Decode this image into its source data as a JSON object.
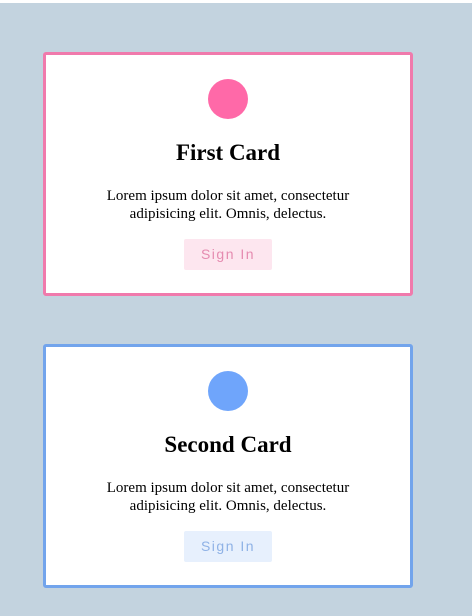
{
  "cards": [
    {
      "title": "First Card",
      "text": "Lorem ipsum dolor sit amet, consectetur adipisicing elit. Omnis, delectus.",
      "button_label": "Sign In",
      "accent_color": "#f07aac"
    },
    {
      "title": "Second Card",
      "text": "Lorem ipsum dolor sit amet, consectetur adipisicing elit. Omnis, delectus.",
      "button_label": "Sign In",
      "accent_color": "#72a4ec"
    }
  ],
  "colors": {
    "page_background": "#c3d3df",
    "pink_dot": "#ff69a8",
    "blue_dot": "#6fa5fb"
  }
}
